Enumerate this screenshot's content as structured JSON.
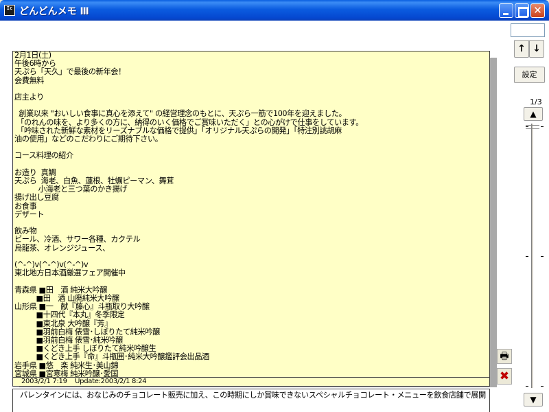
{
  "window": {
    "app_icon_text": "Ic",
    "title": "どんどんメモ Ⅲ"
  },
  "memo": {
    "body": "2月1日(土)\n午後6時から\n天ぷら「天久」で最後の新年会！\n会費無料\n\n店主より\n\n  創業以来 \"おいしい食事に真心を添えて\" の経営理念のもとに、天ぷら一筋で100年を迎えました。\n 「のれんの味を、より多くの方に、納得のいく価格でご賞味いただく」との心がけで仕事をしています。\n 「吟味された新鮮な素材をリーズナブルな価格で提供」「オリジナル天ぷらの開発」「特注別誂胡麻\n油の使用」などのこだわりにご期待下さい。\n\nコース料理の紹介\n\nお造り  真鯛\n天ぷら  海老、白魚、蓮根、牡蠣ピーマン、舞茸\n           小海老と三つ葉のかき揚げ\n揚げ出し豆腐\nお食事\nデザート\n\n飲み物\nビール、冷酒、サワー各種、カクテル\n烏龍茶、オレンジジュース、\n\n(^-^)v(^-^)v(^-^)v\n東北地方日本酒厳選フェア開催中\n\n青森県 ■田　酒 純米大吟醸\n          ■田　酒 山廃純米大吟醸\n山形県 ■一　献『藤心』斗瓶取り大吟醸\n          ■十四代『本丸』冬季限定\n          ■東北泉 大吟醸『芳』\n          ■羽前白梅 俵雪･しぼりたて純米吟醸\n          ■羽前白梅 俵雪･純米吟醸\n          ■くどき上手 しぼりたて純米吟醸生\n          ■くどき上手『命』斗瓶囲･純米大吟醸鑑評会出品酒\n岩手県 ■悠　楽 純米生･美山錦\n宮城県 ■宮寒梅 純米吟醸･愛国",
    "footer": "2003/2/1 7:19    Update:2003/2/1 8:24"
  },
  "next_memo": {
    "preview": "バレンタインには、おなじみのチョコレート販売に加え、この時期にしか賞味できないスペシャルチョコレート・メニューを飲食店舗で展開"
  },
  "side_actions": {
    "print_icon": "printer-icon",
    "delete_icon": "x-icon",
    "print_glyph": "🖶",
    "delete_glyph": "✖"
  },
  "controls": {
    "search_value": "",
    "up_glyph": "↑",
    "down_glyph": "↓",
    "settings_label": "設定",
    "page_counter": "1/3",
    "scroll_up_glyph": "▲",
    "scroll_down_glyph": "▼"
  }
}
